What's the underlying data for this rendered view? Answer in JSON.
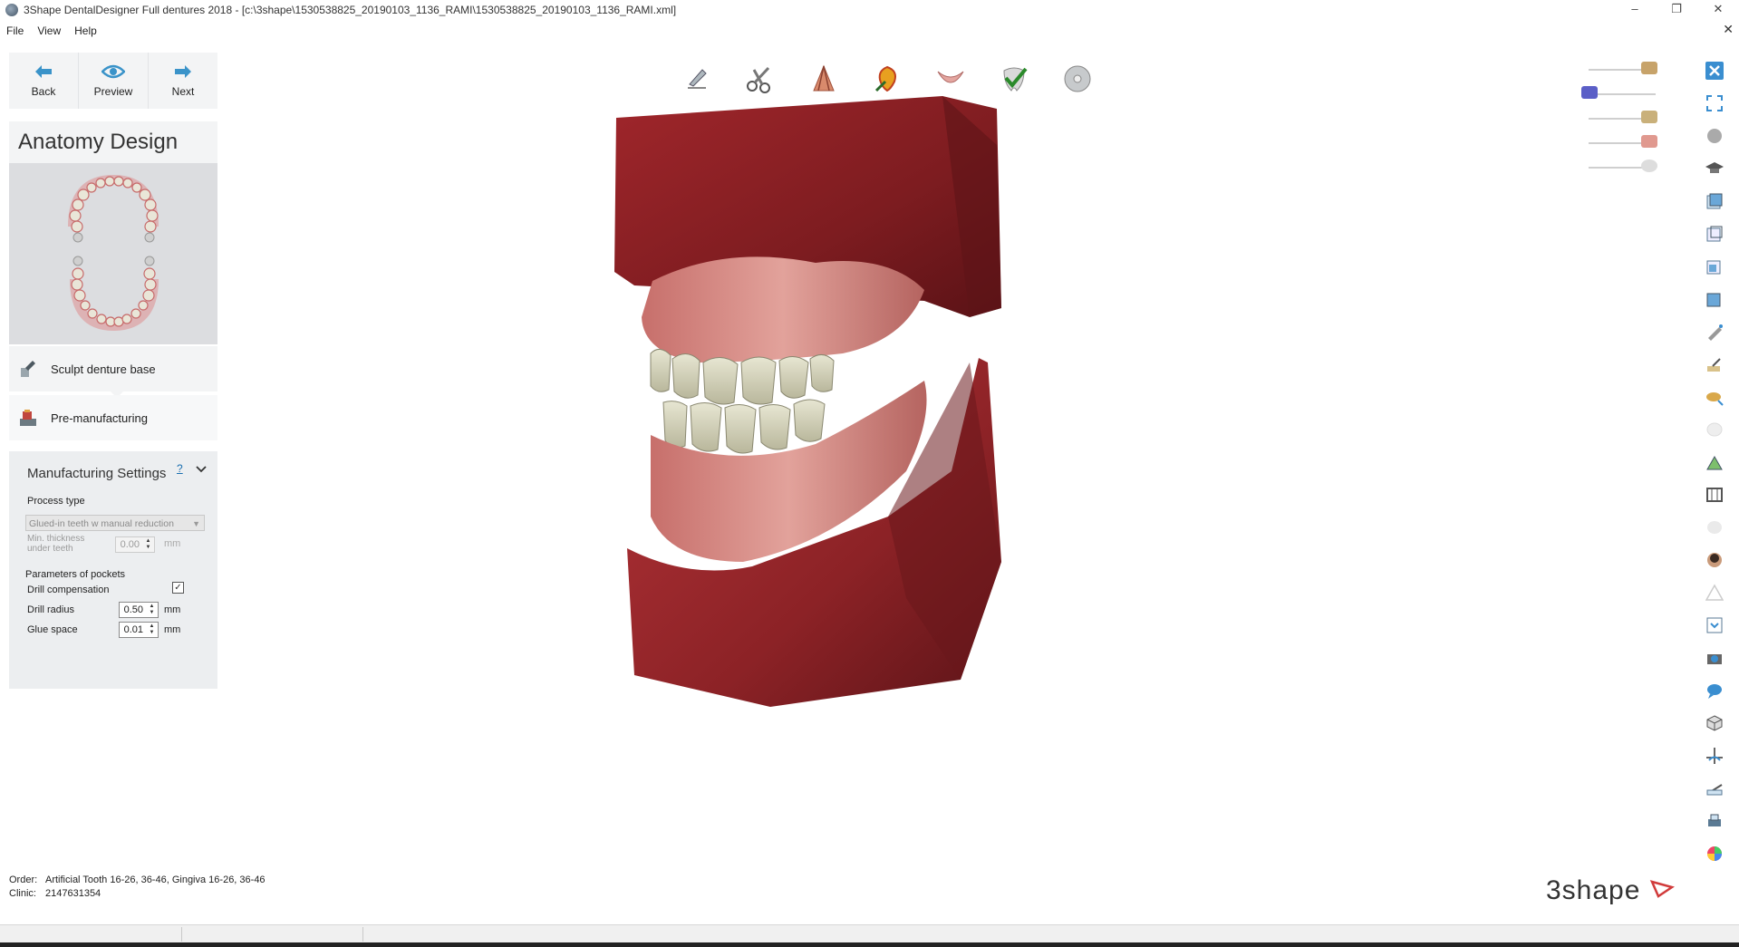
{
  "window": {
    "title": "3Shape DentalDesigner Full dentures 2018 - [c:\\3shape\\1530538825_20190103_1136_RAMI\\1530538825_20190103_1136_RAMI.xml]",
    "controls": {
      "minimize": "–",
      "restore": "❐",
      "close": "✕"
    }
  },
  "menu": {
    "items": [
      "File",
      "View",
      "Help"
    ],
    "close_glyph": "✕"
  },
  "nav": {
    "back": {
      "label": "Back",
      "icon": "arrow-left-icon"
    },
    "preview": {
      "label": "Preview",
      "icon": "eye-icon"
    },
    "next": {
      "label": "Next",
      "icon": "arrow-right-icon"
    }
  },
  "section": {
    "title": "Anatomy Design"
  },
  "steps": [
    {
      "label": "Sculpt denture base",
      "icon": "sculpt-tool-icon"
    },
    {
      "label": "Pre-manufacturing",
      "icon": "manufacturing-icon"
    }
  ],
  "manufacturing_settings": {
    "title": "Manufacturing Settings",
    "help": "?",
    "process_type_label": "Process type",
    "process_type_value": "Glued-in teeth w manual reduction",
    "min_thickness_label_1": "Min. thickness",
    "min_thickness_label_2": "under teeth",
    "min_thickness_value": "0.00",
    "pockets_label": "Parameters of pockets",
    "drill_comp_label": "Drill compensation",
    "drill_comp_checked": true,
    "drill_radius_label": "Drill radius",
    "drill_radius_value": "0.50",
    "glue_space_label": "Glue space",
    "glue_space_value": "0.01",
    "unit": "mm"
  },
  "toolbar_icons": [
    "pen-tool-icon",
    "scissors-tool-icon",
    "gingiva-shape-icon",
    "tooth-paint-icon",
    "lower-jaw-icon",
    "check-tooth-icon",
    "disc-icon"
  ],
  "visibility_sliders": [
    "model-visibility-slider",
    "scan-visibility-slider",
    "teeth-visibility-slider",
    "gingiva-visibility-slider",
    "base-visibility-slider"
  ],
  "right_tools": [
    "close-view-icon",
    "fit-view-icon",
    "globe-icon",
    "graduation-cap-icon",
    "view-cube-front-icon",
    "view-cube-back-icon",
    "view-cube-left-icon",
    "view-cube-right-icon",
    "wax-knife-icon",
    "wax-add-icon",
    "smooth-icon",
    "cup-icon",
    "morph-icon",
    "ruler-icon",
    "cylinder-icon",
    "face-photo-icon",
    "warning-icon",
    "screenshot-icon",
    "camera-icon",
    "chat-icon",
    "cube-icon",
    "cross-section-icon",
    "measure-icon",
    "printer-icon",
    "color-wheel-icon"
  ],
  "footer": {
    "order_label": "Order:",
    "order_value": "Artificial Tooth 16-26, 36-46, Gingiva 16-26, 36-46",
    "clinic_label": "Clinic:",
    "clinic_value": "2147631354",
    "brand": "3shape"
  },
  "colors": {
    "accent": "#3a93c9",
    "model_base": "#8a1f22",
    "gingiva": "#d98580",
    "teeth": "#d9d8c0"
  }
}
